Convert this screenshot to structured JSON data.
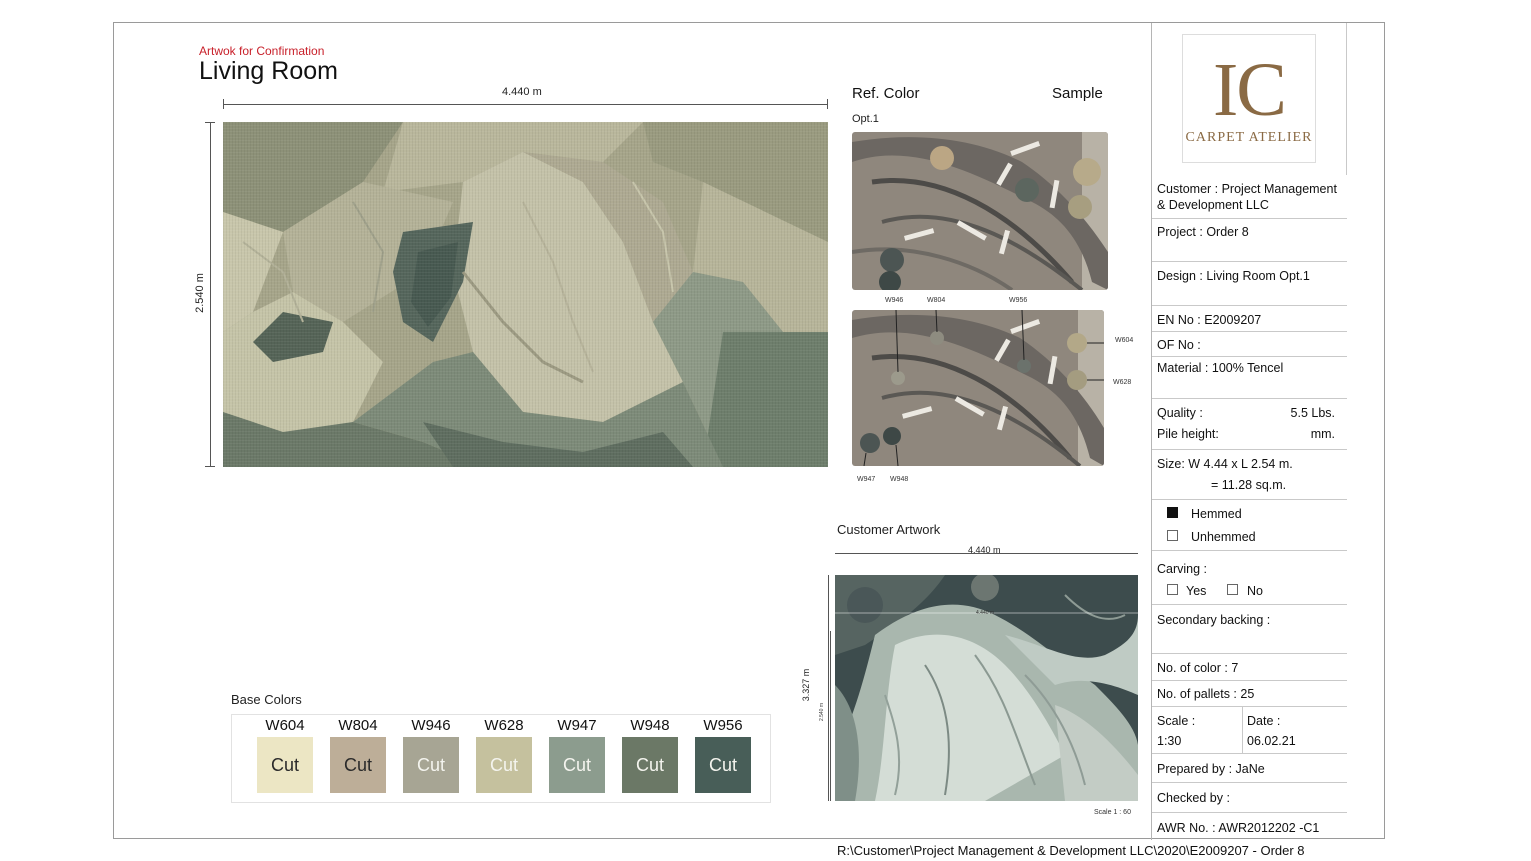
{
  "header": {
    "subtitle": "Artwok for Confirmation",
    "title": "Living Room"
  },
  "main_artwork": {
    "width_label": "4.440 m",
    "height_label": "2.540 m"
  },
  "ref_color": {
    "ref_label": "Ref. Color",
    "sample_label": "Sample",
    "option_label": "Opt.1",
    "sample_tags": {
      "w946": "W946",
      "w804": "W804",
      "w956": "W956",
      "w604": "W604",
      "w628": "W628",
      "w947": "W947",
      "w948": "W948"
    }
  },
  "customer_artwork": {
    "label": "Customer Artwork",
    "width_label": "4.440 m",
    "height_label": "3.327 m",
    "inner_width_label": "4.440 m",
    "inner_height_label": "2.540 m",
    "scale_label": "Scale 1 : 60"
  },
  "base_colors": {
    "title": "Base Colors",
    "swatches": [
      {
        "code": "W604",
        "label": "Cut",
        "color": "#ece6c4",
        "text": "#2a2a2a"
      },
      {
        "code": "W804",
        "label": "Cut",
        "color": "#bdae98",
        "text": "#2a2a2a"
      },
      {
        "code": "W946",
        "label": "Cut",
        "color": "#a7a594",
        "text": "#f4f4ee"
      },
      {
        "code": "W628",
        "label": "Cut",
        "color": "#c5c19e",
        "text": "#f4f4ee"
      },
      {
        "code": "W947",
        "label": "Cut",
        "color": "#8c9c8e",
        "text": "#f4f4ee"
      },
      {
        "code": "W948",
        "label": "Cut",
        "color": "#6b7866",
        "text": "#f4f4ee"
      },
      {
        "code": "W956",
        "label": "Cut",
        "color": "#485e58",
        "text": "#f4f4ee"
      }
    ]
  },
  "spec_panel": {
    "logo_text": "IC",
    "logo_sub": "CARPET ATELIER",
    "customer_line1": "Customer : Project Management",
    "customer_line2": "& Development LLC",
    "project": "Project : Order 8",
    "design": "Design : Living Room Opt.1",
    "en_no": "EN No : E2009207",
    "of_no": "OF No :",
    "material": "Material : 100% Tencel",
    "quality_label": "Quality :",
    "quality_value": "5.5 Lbs.",
    "pile_label": "Pile height:",
    "pile_value": "mm.",
    "size_line1": "Size: W  4.44 x L 2.54 m.",
    "size_line2": "= 11.28 sq.m.",
    "hemmed": "Hemmed",
    "unhemmed": "Unhemmed",
    "carving": "Carving :",
    "yes": "Yes",
    "no": "No",
    "secondary_backing": "Secondary backing :",
    "no_of_color": "No. of color :  7",
    "no_of_pallets": "No. of pallets : 25",
    "scale_label": "Scale :",
    "scale_value": "1:30",
    "date_label": "Date :",
    "date_value": "06.02.21",
    "prepared_by": "Prepared by : JaNe",
    "checked_by": "Checked by :",
    "awr_no": "AWR No. : AWR2012202 -C1"
  },
  "footer": {
    "path": "R:\\Customer\\Project Management & Development LLC\\2020\\E2009207 - Order 8"
  }
}
